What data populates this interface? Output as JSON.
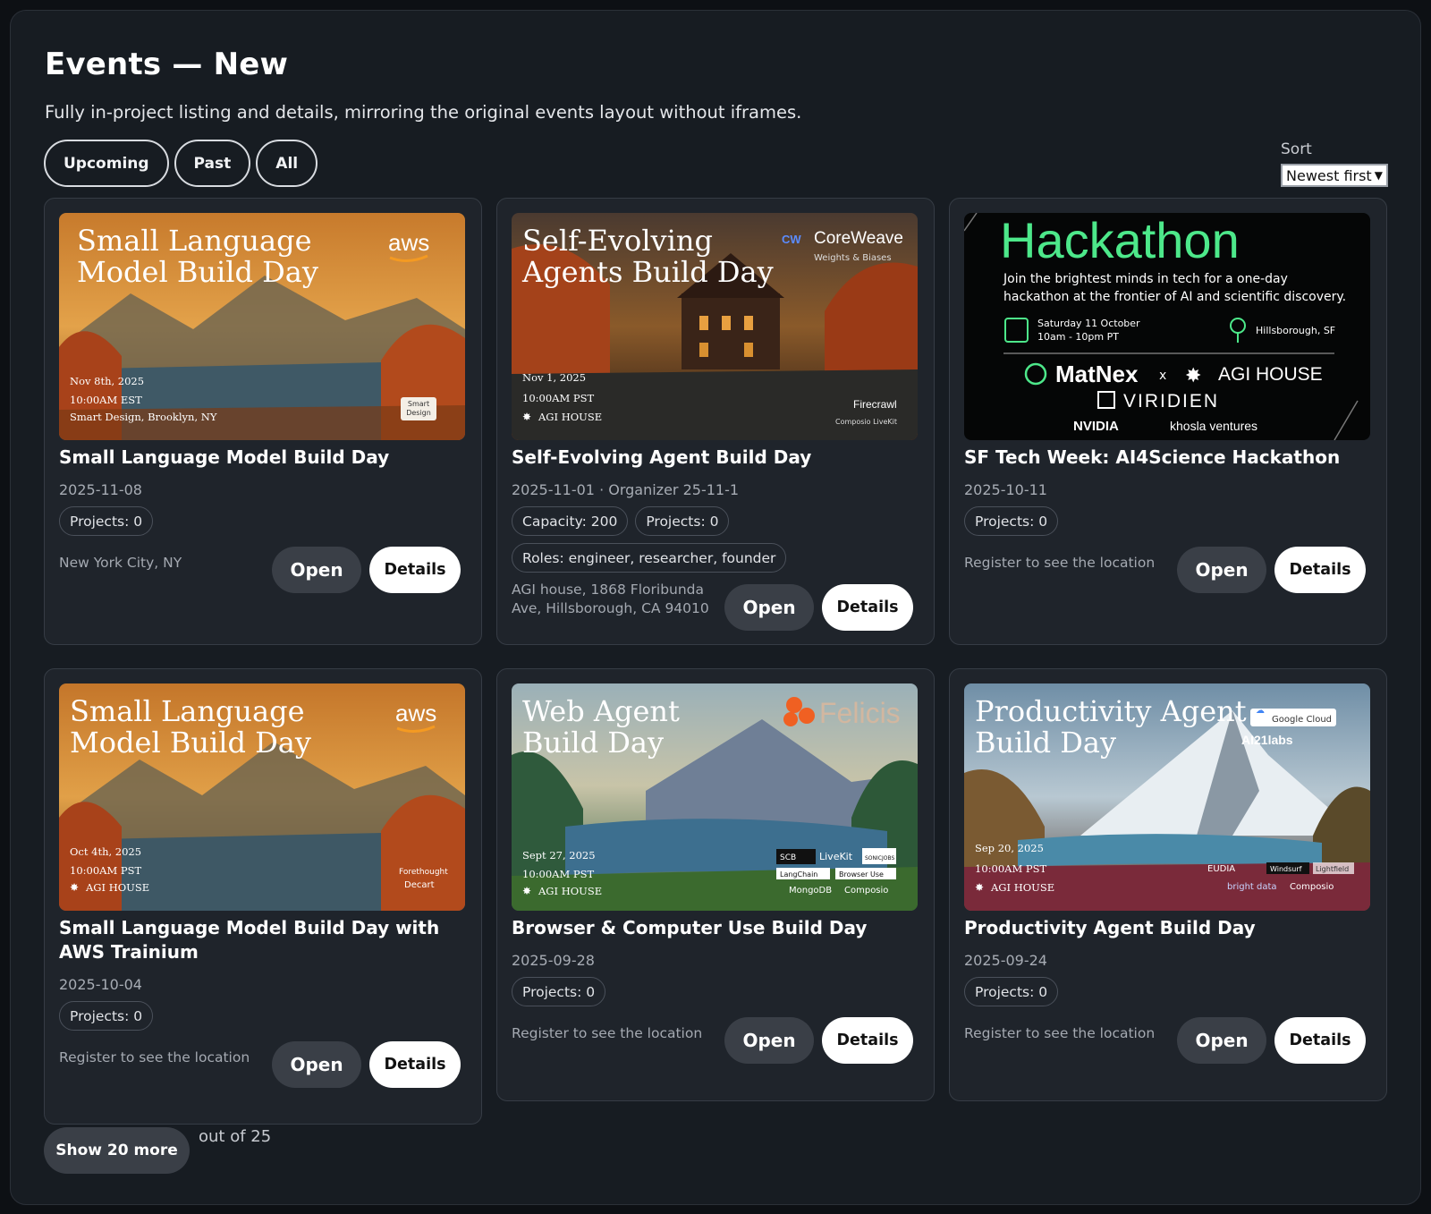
{
  "page": {
    "title": "Events — New",
    "subtitle": "Fully in-project listing and details, mirroring the original events layout without iframes."
  },
  "filters": [
    "Upcoming",
    "Past",
    "All"
  ],
  "sort": {
    "label": "Sort",
    "selected": "Newest first"
  },
  "buttons": {
    "open": "Open",
    "details": "Details"
  },
  "events": [
    {
      "title": "Small Language Model Build Day",
      "date": "2025-11-08",
      "chips": [
        "Projects: 0"
      ],
      "location": "New York City, NY",
      "banner": {
        "heading1": "Small Language",
        "heading2": "Model Build Day",
        "line1": "Nov 8th, 2025",
        "line2": "10:00AM EST",
        "line3": "Smart Design, Brooklyn, NY",
        "brand": "aws",
        "badge1": "Smart",
        "badge2": "Design"
      }
    },
    {
      "title": "Self-Evolving Agent Build Day",
      "date": "2025-11-01 · Organizer 25-11-1",
      "chips": [
        "Capacity: 200",
        "Projects: 0",
        "Roles: engineer, researcher, founder"
      ],
      "location": "AGI house, 1868 Floribunda Ave, Hillsborough, CA 94010",
      "banner": {
        "heading1": "Self-Evolving",
        "heading2": "Agents Build Day",
        "line1": "Nov 1, 2025",
        "line2": "10:00AM PST",
        "line3": "AGI HOUSE",
        "brand": "CoreWeave",
        "brand2": "Weights & Biases",
        "brand3": "Firecrawl",
        "brand4": "Composio   LiveKit"
      }
    },
    {
      "title": "SF Tech Week: AI4Science Hackathon",
      "date": "2025-10-11",
      "chips": [
        "Projects: 0"
      ],
      "location": "Register to see the location",
      "banner": {
        "heading": "Hackathon",
        "desc1": "Join the brightest minds in tech for a one-day",
        "desc2": "hackathon at the frontier of AI and scientific discovery.",
        "date1": "Saturday 11 October",
        "date2": "10am - 10pm PT",
        "place": "Hillsborough, SF",
        "sponsor1": "MatNex",
        "x": "x",
        "sponsor2": "AGI HOUSE",
        "sponsor3": "VIRIDIEN",
        "sponsor4": "NVIDIA",
        "sponsor5": "khosla ventures"
      }
    },
    {
      "title": "Small Language Model Build Day with AWS Trainium",
      "date": "2025-10-04",
      "chips": [
        "Projects: 0"
      ],
      "location": "Register to see the location",
      "banner": {
        "heading1": "Small Language",
        "heading2": "Model Build Day",
        "line1": "Oct 4th, 2025",
        "line2": "10:00AM PST",
        "line3": "AGI HOUSE",
        "brand": "aws",
        "brand2": "Forethought",
        "brand3": "Decart"
      }
    },
    {
      "title": "Browser & Computer Use Build Day",
      "date": "2025-09-28",
      "chips": [
        "Projects: 0"
      ],
      "location": "Register to see the location",
      "banner": {
        "heading1": "Web Agent",
        "heading2": "Build Day",
        "line1": "Sept 27, 2025",
        "line2": "10:00AM PST",
        "line3": "AGI HOUSE",
        "brand": "Felicis",
        "s1": "SCB",
        "s2": "LiveKit",
        "s3": "SONICJOBS",
        "s4": "LangChain",
        "s5": "Browser Use",
        "s6": "MongoDB",
        "s7": "Composio"
      }
    },
    {
      "title": "Productivity Agent Build Day",
      "date": "2025-09-24",
      "chips": [
        "Projects: 0"
      ],
      "location": "Register to see the location",
      "banner": {
        "heading1": "Productivity Agent",
        "heading2": "Build Day",
        "line1": "Sep 20, 2025",
        "line2": "10:00AM PST",
        "line3": "AGI HOUSE",
        "brand": "Google Cloud",
        "brand2": "AI21labs",
        "s1": "EUDIA",
        "s2": "Windsurf",
        "s3": "Lightfield",
        "s4": "bright data",
        "s5": "Composio"
      }
    }
  ],
  "pagination": {
    "more_label": "Show 20 more",
    "total_text": "out of 25"
  },
  "colors": {
    "background": "#171c22",
    "card": "#1f242b",
    "accent": "#4de88a"
  }
}
